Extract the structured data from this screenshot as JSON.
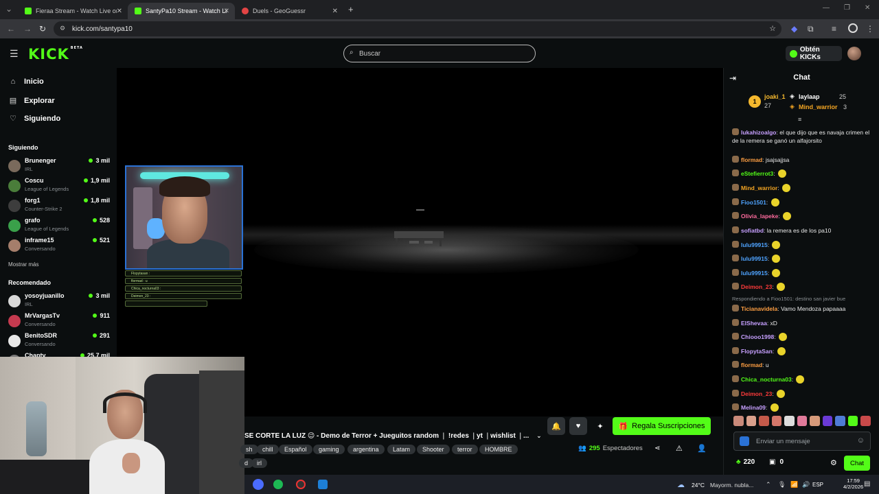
{
  "browser": {
    "tabs": [
      {
        "title": "Fieraa Stream - Watch Live on K",
        "fav": "#53fc18"
      },
      {
        "title": "SantyPa10 Stream - Watch Live",
        "fav": "#53fc18"
      },
      {
        "title": "Duels - GeoGuessr",
        "fav": "#e24444"
      }
    ],
    "new_tab": "+",
    "url": "kick.com/santypa10"
  },
  "header": {
    "logo": "KICK",
    "logo_beta": "BETA",
    "search_placeholder": "Buscar",
    "kicks_label": "Obtén KICKs"
  },
  "sidebar": {
    "nav": [
      {
        "label": "Inicio",
        "icon": "home-icon"
      },
      {
        "label": "Explorar",
        "icon": "compass-icon"
      },
      {
        "label": "Siguiendo",
        "icon": "heart-icon"
      }
    ],
    "following_title": "Siguiendo",
    "following": [
      {
        "name": "Brunenger",
        "category": "IRL",
        "viewers": "3 mil",
        "color": "#7a6a5c"
      },
      {
        "name": "Coscu",
        "category": "League of Legends",
        "viewers": "1,9 mil",
        "color": "#4a7d3a"
      },
      {
        "name": "forg1",
        "category": "Counter-Strike 2",
        "viewers": "1,8 mil",
        "color": "#3d3d3d"
      },
      {
        "name": "grafo",
        "category": "League of Legends",
        "viewers": "528",
        "color": "#3aa04a"
      },
      {
        "name": "inframe15",
        "category": "Conversando",
        "viewers": "521",
        "color": "#a57e6b"
      }
    ],
    "show_more": "Mostrar más",
    "recommended_title": "Recomendado",
    "recommended": [
      {
        "name": "yosoyjuanillo",
        "category": "IRL",
        "viewers": "3 mil",
        "color": "#d8d8d8"
      },
      {
        "name": "MrVargasTv",
        "category": "Conversando",
        "viewers": "911",
        "color": "#c43a4f"
      },
      {
        "name": "BenitoSDR",
        "category": "Conversando",
        "viewers": "291",
        "color": "#e8e8e8"
      },
      {
        "name": "Chapty",
        "category": "",
        "viewers": "25,7 mil",
        "color": "#777"
      }
    ]
  },
  "pip_chat": [
    "Flopytasan : ",
    "flormad : u",
    "Chica_nocturna03 : ",
    "Deimon_23 : "
  ],
  "stream": {
    "title": "SE CORTE LA LUZ 😉 - Demo de Terror + Jueguitos random  ❘ !redes ❘yt ❘wishlist ❘...",
    "tags": [
      "sh",
      "chill",
      "Español",
      "gaming",
      "argentina",
      "Latam",
      "Shooter",
      "terror",
      "HOMBRE",
      "d",
      "irl"
    ],
    "subscribe_label": "Regala Suscripciones",
    "viewers_count": "295",
    "viewers_label": "Espectadores"
  },
  "chat": {
    "title": "Chat",
    "leaderboard": [
      {
        "rank": "1",
        "name": "joaki_1",
        "count": "27",
        "color": "#f5b82e"
      },
      {
        "name": "laylaap",
        "count": "25",
        "color": "#ffffff"
      },
      {
        "name": "Mind_warrior",
        "count": "3",
        "color": "#f5a623"
      }
    ],
    "messages": [
      {
        "user": "lukahizoalgo",
        "text": "el que dijo que es navaja crimen el de la remera se ganó un alfajorsito",
        "color": "#c7a0ff"
      },
      {
        "user": "flormad",
        "text": "jsajsajjsa",
        "color": "#ff9f43"
      },
      {
        "user": "eStefierrot3",
        "text": "",
        "color": "#53fc18"
      },
      {
        "user": "Mind_warrior",
        "text": "",
        "color": "#f5a623"
      },
      {
        "user": "Fioo1501",
        "text": "",
        "color": "#4fa3ff"
      },
      {
        "user": "Olivia_lapeke",
        "text": "",
        "color": "#ff6b9e"
      },
      {
        "user": "sofiatbd",
        "text": "la remera es de los pa10",
        "color": "#c7a0ff"
      },
      {
        "user": "lulu99915",
        "text": "",
        "color": "#4fa3ff"
      },
      {
        "user": "lulu99915",
        "text": "",
        "color": "#4fa3ff"
      },
      {
        "user": "lulu99915",
        "text": "",
        "color": "#4fa3ff"
      },
      {
        "user": "Deimon_23",
        "text": "",
        "color": "#ff3b3b"
      },
      {
        "user": "Ticianavidela",
        "text": "Vamo Mendoza papaaaa",
        "color": "#ff9f43",
        "reply": "Respondiendo a Fioo1501: destino san javier bue"
      },
      {
        "user": "ElShevaa",
        "text": "xD",
        "color": "#c7a0ff"
      },
      {
        "user": "Chiooo1998",
        "text": "",
        "color": "#c7a0ff"
      },
      {
        "user": "FlopytaSan",
        "text": "",
        "color": "#c7a0ff"
      },
      {
        "user": "flormad",
        "text": "u",
        "color": "#ff9f43"
      },
      {
        "user": "Chica_nocturna03",
        "text": "",
        "color": "#53fc18"
      },
      {
        "user": "Deimon_23",
        "text": "",
        "color": "#ff3b3b"
      },
      {
        "user": "Melina09",
        "text": "",
        "color": "#c7a0ff"
      }
    ],
    "input_placeholder": "Enviar un mensaje",
    "points": "220",
    "gifts": "0",
    "send_label": "Chat"
  },
  "taskbar": {
    "temp": "24°C",
    "weather": "Mayorm. nubla...",
    "lang": "ESP",
    "time": "17:59",
    "date": "4/2/2026"
  }
}
